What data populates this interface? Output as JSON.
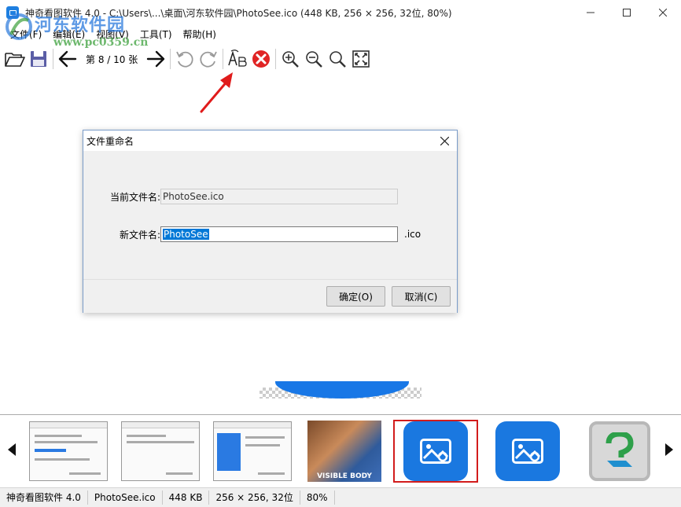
{
  "window": {
    "title": "神奇看图软件 4.0 - C:\\Users\\...\\桌面\\河东软件园\\PhotoSee.ico (448 KB, 256 × 256, 32位, 80%)",
    "minimize_icon": "minimize-icon",
    "maximize_icon": "maximize-icon",
    "close_icon": "close-icon"
  },
  "watermark": {
    "text": "河东软件园",
    "url": "www.pc0359.cn"
  },
  "menu": [
    {
      "label": "文件(F)"
    },
    {
      "label": "编辑(E)"
    },
    {
      "label": "视图(V)"
    },
    {
      "label": "工具(T)"
    },
    {
      "label": "帮助(H)"
    }
  ],
  "toolbar": {
    "page_indicator": "第 8 / 10 张",
    "icons": [
      "open-folder-icon",
      "save-icon",
      "previous-arrow-icon",
      "next-arrow-icon",
      "rotate-left-icon",
      "rotate-right-icon",
      "rename-icon",
      "delete-icon",
      "zoom-in-icon",
      "zoom-out-icon",
      "zoom-actual-icon",
      "fit-screen-icon"
    ]
  },
  "dialog": {
    "title": "文件重命名",
    "current_label": "当前文件名:",
    "current_value": "PhotoSee.ico",
    "new_label": "新文件名:",
    "new_value": "PhotoSee",
    "extension": ".ico",
    "ok_label": "确定(O)",
    "cancel_label": "取消(C)"
  },
  "thumbnails": {
    "selected_index": 4,
    "items": [
      "screenshot-1",
      "screenshot-2",
      "screenshot-3",
      "visible-body",
      "photosee-icon",
      "photosee-icon-2",
      "help-icon"
    ],
    "visible_body_label": "VISIBLE BODY"
  },
  "status": {
    "app": "神奇看图软件 4.0",
    "filename": "PhotoSee.ico",
    "size": "448 KB",
    "dimensions": "256 × 256, 32位",
    "zoom": "80%"
  },
  "colors": {
    "accent": "#1877e6",
    "selection_border": "#d21c1c",
    "delete_red": "#e02424",
    "annotation_arrow": "#e01b1b"
  }
}
